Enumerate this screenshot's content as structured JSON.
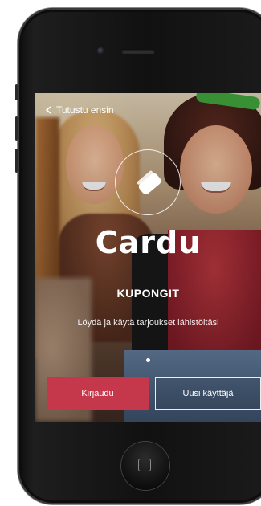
{
  "screen": {
    "nav": {
      "back_label": "Tutustu ensin"
    },
    "brand": {
      "name": "Cardu"
    },
    "subtitle": "KUPONGIT",
    "tagline": "Löydä ja käytä tarjoukset lähistöltäsi",
    "pager": {
      "count": 1,
      "active": 1
    },
    "buttons": {
      "login_label": "Kirjaudu",
      "new_user_label": "Uusi käyttäjä"
    }
  },
  "colors": {
    "accent": "#c5384b",
    "phone_body": "#111111",
    "text": "#ffffff"
  },
  "icons": [
    "chevron-left-icon",
    "cardu-logo-icon",
    "home-button-icon"
  ]
}
